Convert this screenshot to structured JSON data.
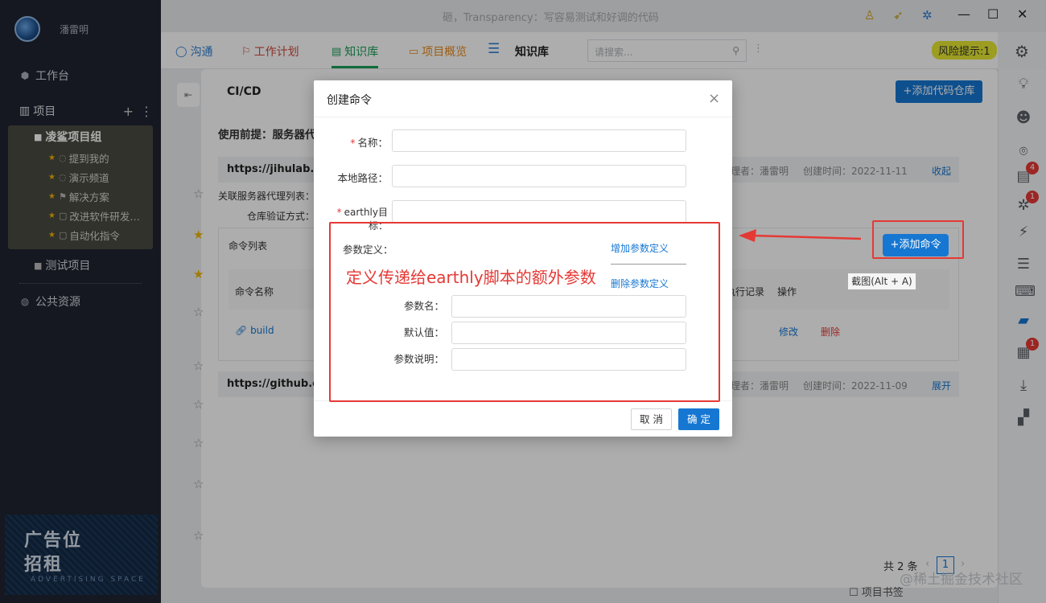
{
  "window": {
    "title": "砸，Transparency：写容易测试和好调的代码"
  },
  "sidebar": {
    "username": "潘雷明",
    "workbench": "工作台",
    "projects_label": "项目",
    "group_name": "凌鲨项目组",
    "group_items": [
      "提到我的",
      "演示频道",
      "解决方案",
      "改进软件研发…",
      "自动化指令"
    ],
    "test_project": "测试项目",
    "public_resources": "公共资源",
    "ad_line1": "广告位",
    "ad_line2": "招租",
    "ad_sub": "ADVERTISING SPACE"
  },
  "tabs": {
    "chat": "沟通",
    "plan": "工作计划",
    "knowledge": "知识库",
    "overview": "项目概览",
    "current": "知识库",
    "search_placeholder": "请搜索...",
    "risk": "风险提示:1"
  },
  "rail": {
    "badges": [
      "4",
      "1",
      "1"
    ]
  },
  "content": {
    "title": "CI/CD",
    "add_repo_button": "+添加代码仓库",
    "premise": "使用前提：服务器代",
    "repo1_url": "https://jihulab.co",
    "repo1_creator": "理者：潘雷明",
    "repo1_created": "创建时间：2022-11-11",
    "repo1_action": "收起",
    "proxy_label": "关联服务器代理列表：",
    "auth_label": "仓库验证方式：",
    "cmd_list": "命令列表",
    "add_cmd_button": "+添加命令",
    "col_name": "命令名称",
    "col_records": "执行记录",
    "col_ops": "操作",
    "row_name": "build",
    "row_edit": "修改",
    "row_delete": "删除",
    "repo2_url": "https://github.co",
    "repo2_creator": "理者：潘雷明",
    "repo2_created": "创建时间：2022-11-09",
    "repo2_action": "展开",
    "tooltip": "截图(Alt + A)",
    "pager_total": "共 2 条",
    "pager_page": "1",
    "watermark": "@稀土掘金技术社区",
    "bookmarks": "项目书签"
  },
  "modal": {
    "title": "创建命令",
    "name_label": "名称：",
    "path_label": "本地路径：",
    "target_label": "earthly目标：",
    "param_def_label": "参数定义：",
    "add_param_link": "增加参数定义",
    "del_param_link": "删除参数定义",
    "param_name_label": "参数名：",
    "param_default_label": "默认值：",
    "param_desc_label": "参数说明：",
    "cancel": "取 消",
    "ok": "确 定"
  },
  "annotation": {
    "text": "定义传递给earthly脚本的额外参数",
    "color": "#e53935"
  },
  "colors": {
    "primary": "#1677d2",
    "success": "#18a058",
    "sidebar_bg": "#1f2430",
    "risk_bg": "#e6e832"
  }
}
